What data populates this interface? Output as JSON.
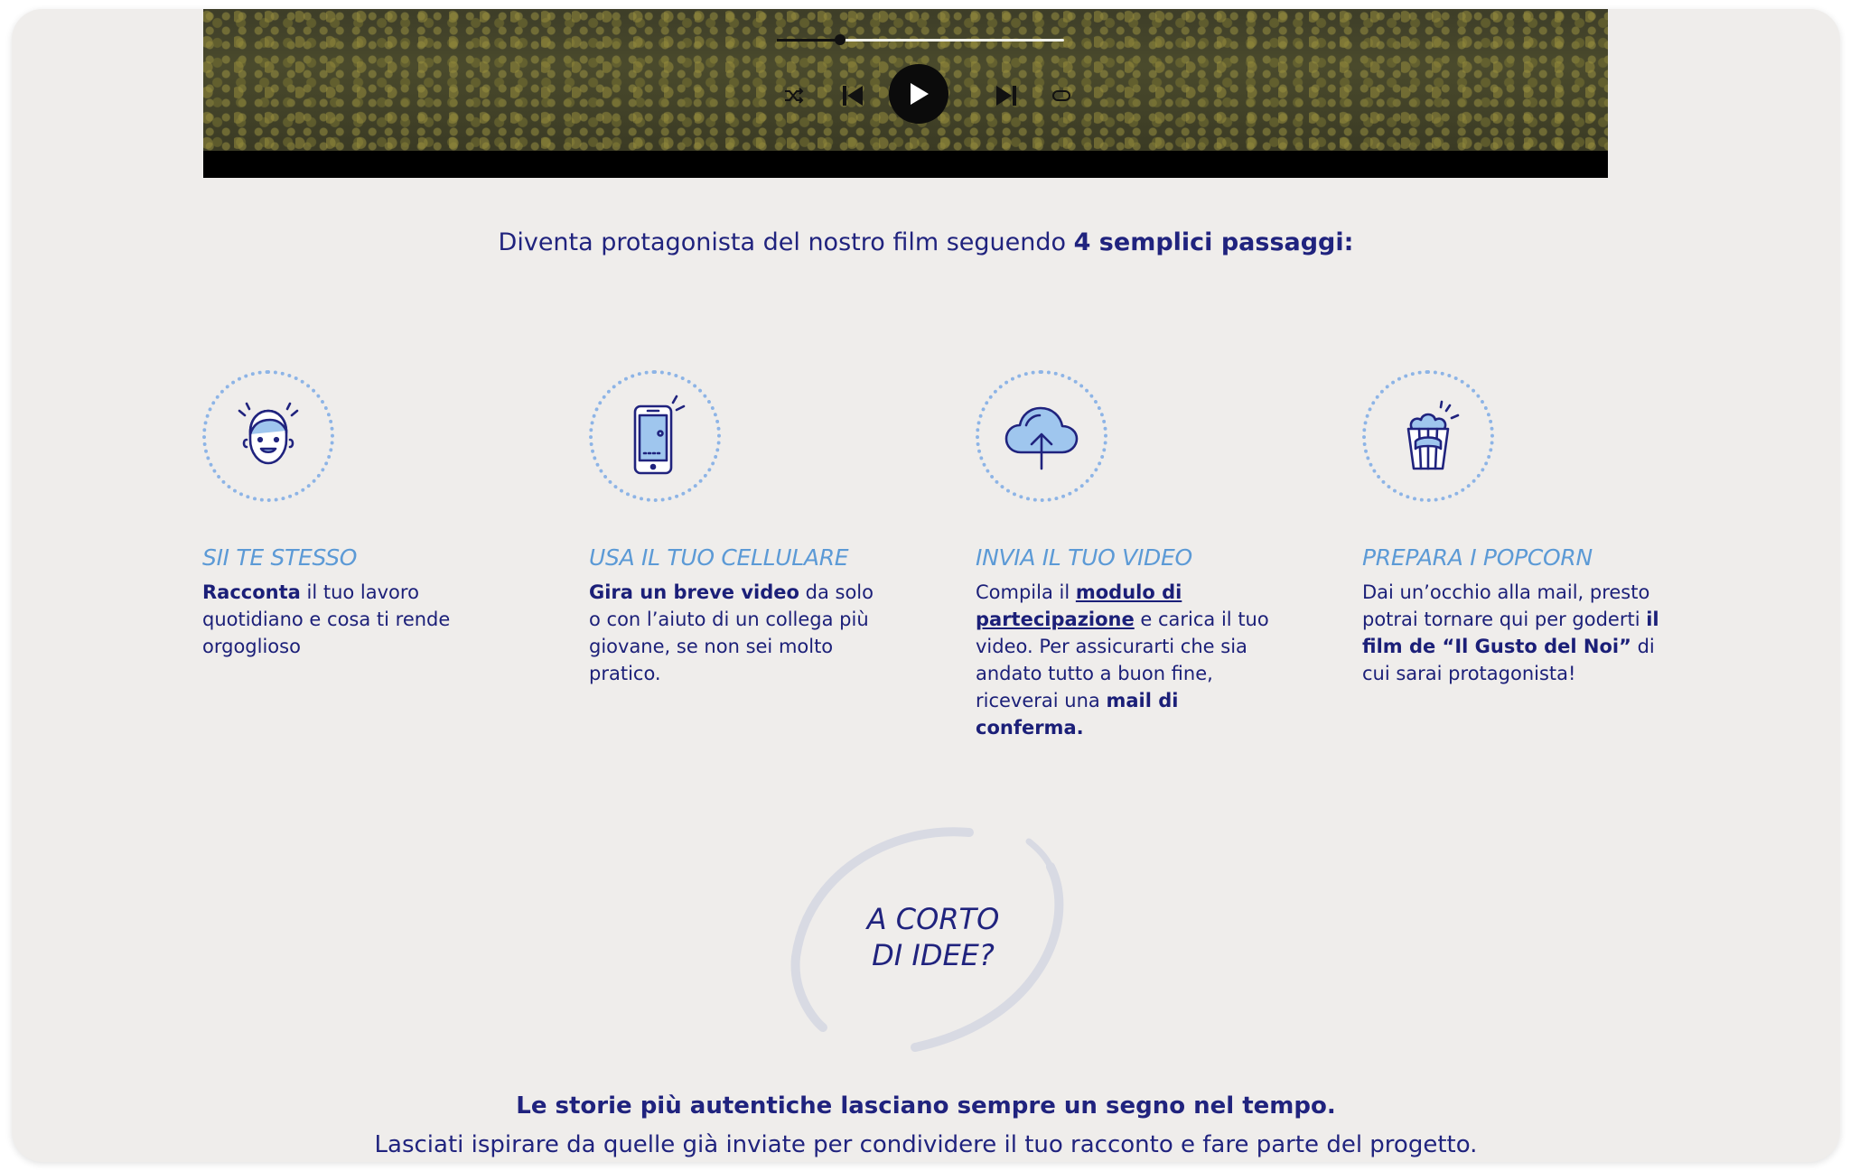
{
  "player": {
    "progress": 0.22,
    "controls": [
      "shuffle-icon",
      "skip-back-icon",
      "play-icon",
      "skip-forward-icon",
      "repeat-icon"
    ]
  },
  "intro": {
    "lead": "Diventa protagonista del nostro film seguendo ",
    "emphasis": "4 semplici passaggi:"
  },
  "steps": [
    {
      "icon": "smiling-face-icon",
      "title": "SII TE STESSO",
      "bold": "Racconta",
      "text": " il tuo lavoro quotidiano e cosa ti rende orgoglioso"
    },
    {
      "icon": "smartphone-icon",
      "title": "USA IL TUO CELLULARE",
      "bold": "Gira un breve video",
      "text": " da solo o con l’aiuto di un collega più giovane, se non sei molto pratico."
    },
    {
      "icon": "cloud-upload-icon",
      "title": "INVIA IL TUO VIDEO",
      "pre": "Compila il ",
      "link": "modulo di partecipazione",
      "mid": " e carica il tuo video. Per assicurarti che sia andato tutto a buon fine, riceverai una ",
      "bold_end": "mail di conferma."
    },
    {
      "icon": "popcorn-icon",
      "title": "PREPARA I POPCORN",
      "pre": "Dai un’occhio alla mail, presto potrai tornare qui per goderti ",
      "bold": "il film de “Il Gusto del Noi”",
      "post": " di cui sarai protagonista!"
    }
  ],
  "ideas": {
    "line1": "A CORTO",
    "line2": "DI IDEE?"
  },
  "footer": {
    "headline": "Le storie più autentiche lasciano sempre un segno nel tempo.",
    "sub": "Lasciati ispirare da quelle già inviate per condividere il tuo racconto e fare parte del progetto."
  },
  "colors": {
    "navy": "#20237e",
    "accent": "#5c9ad6",
    "background": "#efedeb"
  }
}
